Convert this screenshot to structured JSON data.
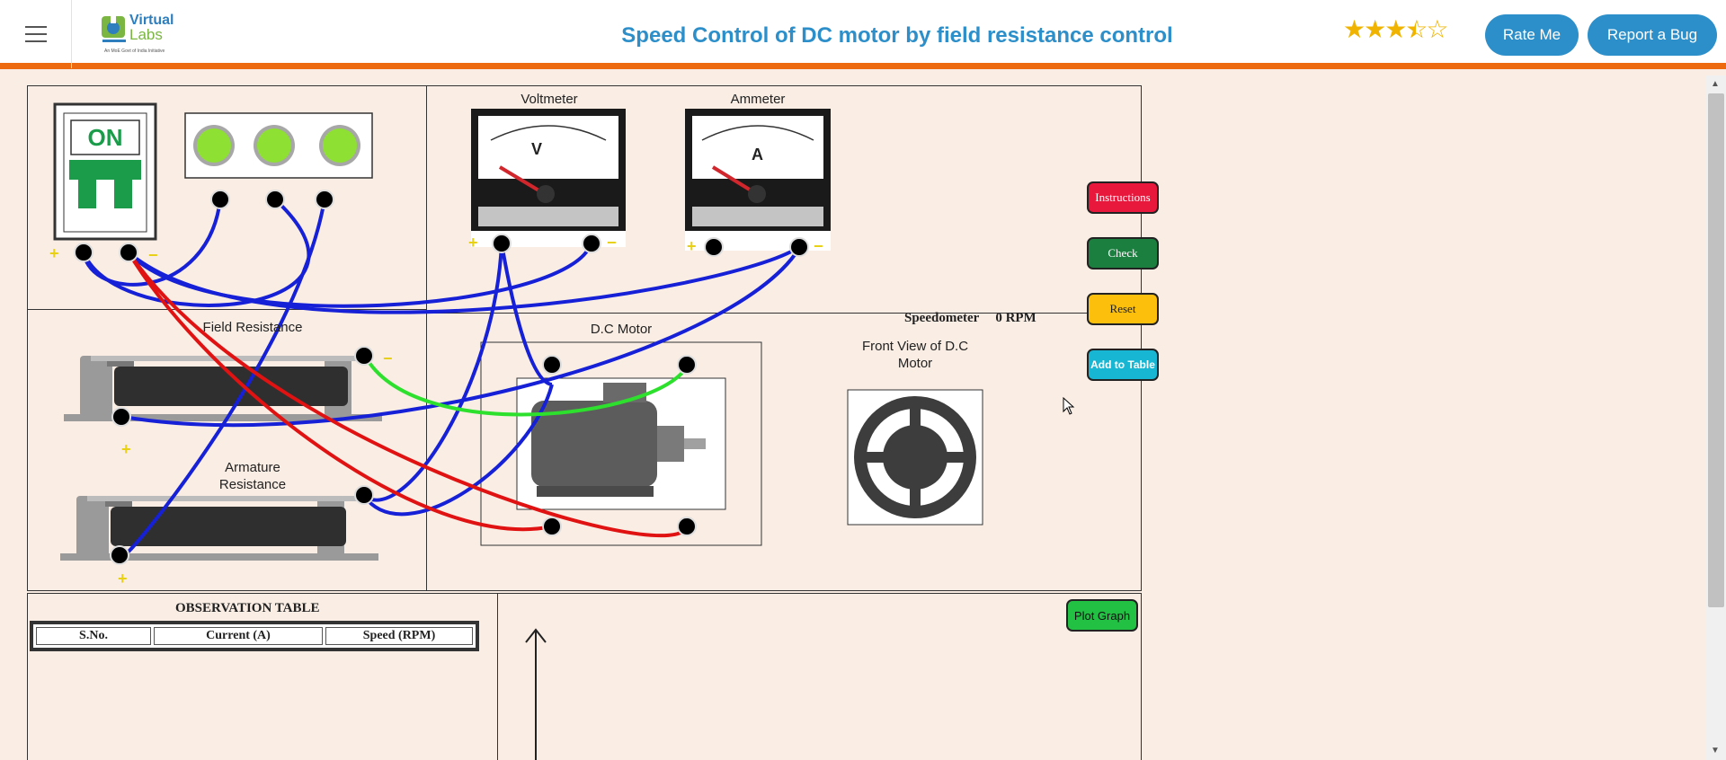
{
  "header": {
    "title": "Speed Control of DC motor by field resistance control",
    "logo_line1": "Virtual",
    "logo_line2": "Labs",
    "logo_tagline": "An MoE Govt of India Initiative",
    "rating": 3.5,
    "rate_label": "Rate Me",
    "bug_label": "Report a Bug"
  },
  "lab": {
    "switch_label": "ON",
    "voltmeter_label": "Voltmeter",
    "voltmeter_symbol": "V",
    "ammeter_label": "Ammeter",
    "ammeter_symbol": "A",
    "field_resistance_label": "Field Resistance",
    "armature_resistance_label": "Armature\nResistance",
    "motor_label": "D.C Motor",
    "front_view_label": "Front View of D.C Motor",
    "speedometer_label": "Speedometer",
    "speedometer_value": "0 RPM",
    "plus": "+",
    "minus": "−",
    "buttons": {
      "instructions": "Instructions",
      "check": "Check",
      "reset": "Reset",
      "add_to_table": "Add to Table"
    }
  },
  "observation": {
    "title": "OBSERVATION TABLE",
    "columns": [
      "S.No.",
      "Current (A)",
      "Speed (RPM)"
    ],
    "plot_label": "Plot Graph"
  },
  "colors": {
    "accent": "#2d8fc9",
    "header_border": "#ee6a11",
    "background": "#f9ede4",
    "wire_blue": "#1620d6",
    "wire_red": "#e01212",
    "wire_green": "#2ee02e"
  }
}
